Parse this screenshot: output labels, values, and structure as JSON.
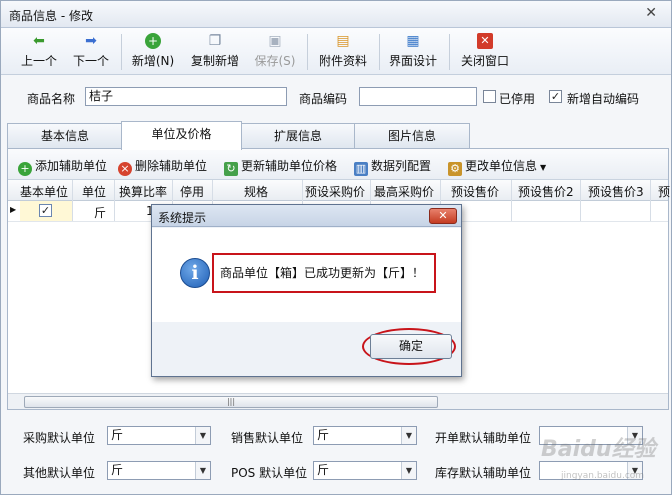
{
  "window": {
    "title": "商品信息 - 修改",
    "close_glyph": "✕"
  },
  "toolbar": {
    "prev": "上一个",
    "next": "下一个",
    "add": "新增(N)",
    "copy_add": "复制新增",
    "save": "保存(S)",
    "attachments": "附件资料",
    "ui_design": "界面设计",
    "close": "关闭窗口"
  },
  "product": {
    "name_label": "商品名称",
    "name_value": "桔子",
    "code_label": "商品编码",
    "code_value": "",
    "disabled_label": "已停用",
    "auto_code_label": "新增自动编码"
  },
  "tabs": [
    "基本信息",
    "单位及价格",
    "扩展信息",
    "图片信息"
  ],
  "unit_toolbar": {
    "add_unit": "添加辅助单位",
    "delete_unit": "删除辅助单位",
    "update_price": "更新辅助单位价格",
    "column_config": "数据列配置",
    "change_unit": "更改单位信息"
  },
  "grid": {
    "columns": [
      "基本单位",
      "单位",
      "换算比率",
      "停用",
      "规格",
      "预设采购价",
      "最高采购价",
      "预设售价",
      "预设售价2",
      "预设售价3",
      "预"
    ],
    "rows": [
      {
        "unit": "斤",
        "ratio": "1"
      }
    ]
  },
  "defaults": {
    "purchase_label": "采购默认单位",
    "purchase_value": "斤",
    "sales_label": "销售默认单位",
    "sales_value": "斤",
    "bill_aux_label": "开单默认辅助单位",
    "bill_aux_value": "",
    "other_label": "其他默认单位",
    "other_value": "斤",
    "pos_label": "POS 默认单位",
    "pos_value": "斤",
    "stock_aux_label": "库存默认辅助单位",
    "stock_aux_value": ""
  },
  "dialog": {
    "title": "系统提示",
    "message": "商品单位【箱】已成功更新为【斤】！",
    "ok": "确定"
  },
  "watermark": {
    "text": "Baidu经验",
    "sub": "jingyan.baidu.com"
  }
}
